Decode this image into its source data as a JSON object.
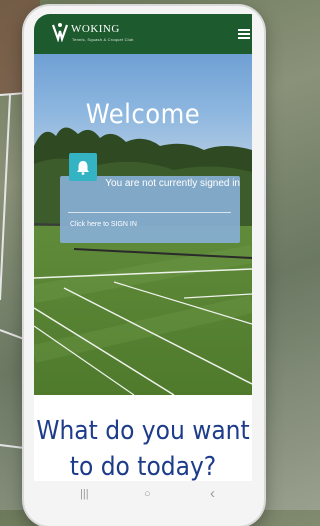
{
  "header": {
    "club_name": "WOKING",
    "club_subtitle": "Tennis, Squash & Croquet Club"
  },
  "hero": {
    "welcome_title": "Welcome",
    "signin_status": "You are not currently signed in",
    "signin_link": "Click here to SIGN IN"
  },
  "main": {
    "question": "What do you want to do today?"
  },
  "android_nav": {
    "recents": "|||",
    "home": "○",
    "back": "‹"
  },
  "colors": {
    "header_green": "#1d5a2e",
    "accent_teal": "#33b3c4",
    "heading_blue": "#1d3d8a"
  }
}
